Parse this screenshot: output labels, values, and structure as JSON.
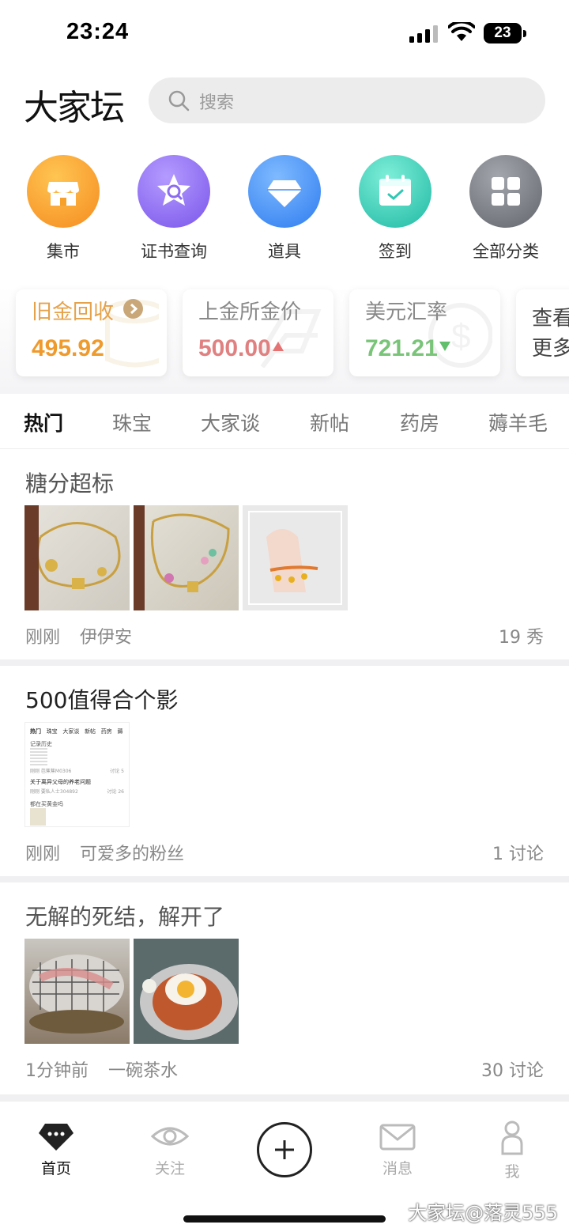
{
  "status": {
    "time": "23:24",
    "battery": "23"
  },
  "header": {
    "logo": "大家坛",
    "search_placeholder": "搜索"
  },
  "quick_links": [
    {
      "label": "集市",
      "icon": "shop-icon",
      "color": "#f7a12a"
    },
    {
      "label": "证书查询",
      "icon": "star-search-icon",
      "color": "#8c6cf0"
    },
    {
      "label": "道具",
      "icon": "diamond-icon",
      "color": "#3e8df5"
    },
    {
      "label": "签到",
      "icon": "calendar-check-icon",
      "color": "#30c8b4"
    },
    {
      "label": "全部分类",
      "icon": "grid-icon",
      "color": "#777a82"
    }
  ],
  "prices": [
    {
      "title": "旧金回收",
      "value": "495.92",
      "title_color": "#e6a24a",
      "value_color": "#ef9a2c"
    },
    {
      "title": "上金所金价",
      "value": "500.00",
      "trend": "up",
      "title_color": "#888888",
      "value_color": "#e08080"
    },
    {
      "title": "美元汇率",
      "value": "721.21",
      "trend": "down",
      "title_color": "#888888",
      "value_color": "#7ac47a"
    },
    {
      "title_line1": "查看",
      "title_line2": "更多"
    }
  ],
  "tabs": [
    "热门",
    "珠宝",
    "大家谈",
    "新帖",
    "药房",
    "薅羊毛"
  ],
  "posts": [
    {
      "title": "糖分超标",
      "time": "刚刚",
      "author": "伊伊安",
      "count": "19 秀"
    },
    {
      "title": "500值得合个影",
      "time": "刚刚",
      "author": "可爱多的粉丝",
      "count": "1 讨论",
      "screenshot": {
        "tabs": [
          "热门",
          "珠宝",
          "大家谈",
          "新帖",
          "药房",
          "薅"
        ],
        "line1": "记录历史",
        "meta1": "刚刚 芭蕉蕉M0306",
        "meta1_count": "讨论 5",
        "line2": "关于离异父母的养老问题",
        "meta2": "刚刚 要私人士304892",
        "meta2_count": "讨论 26",
        "line3": "都在买黄金吗"
      }
    },
    {
      "title": "无解的死结，解开了",
      "time": "1分钟前",
      "author": "一碗茶水",
      "count": "30 讨论"
    }
  ],
  "bottom_nav": [
    {
      "label": "首页",
      "active": true
    },
    {
      "label": "关注"
    },
    {
      "label": "消息"
    },
    {
      "label": "我"
    }
  ],
  "watermark": "大家坛@落灵555"
}
